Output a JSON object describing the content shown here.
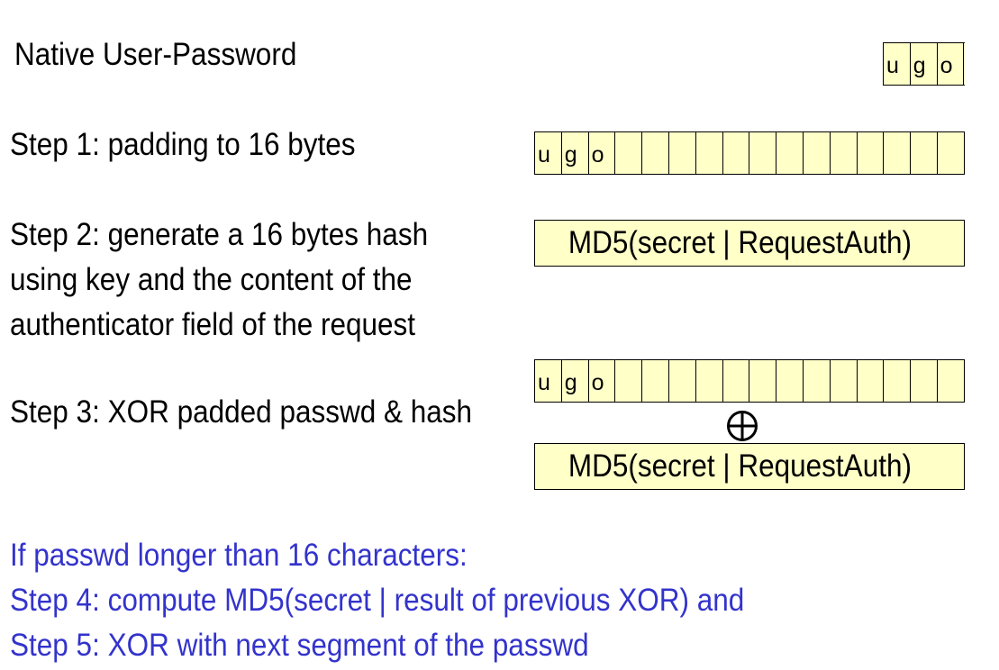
{
  "title": "Native User-Password",
  "password_chars": [
    "u",
    "g",
    "o"
  ],
  "padded_cells": [
    "u",
    "g",
    "o",
    "",
    "",
    "",
    "",
    "",
    "",
    "",
    "",
    "",
    "",
    "",
    "",
    ""
  ],
  "steps": {
    "step1": "Step 1: padding to 16 bytes",
    "step2_line1": "Step 2: generate a 16 bytes hash",
    "step2_line2": "using key and the content of the",
    "step2_line3": "authenticator field of the request",
    "step3": "Step 3: XOR padded passwd & hash"
  },
  "hash_label": "MD5(secret | RequestAuth)",
  "xor_symbol": "xor-operator",
  "notes": [
    "If passwd longer than 16 characters:",
    "Step 4: compute MD5(secret | result of previous XOR) and",
    "Step 5: XOR with next segment of the passwd"
  ],
  "colors": {
    "cell_fill": "#ffffc8",
    "note_text": "#3333cc"
  }
}
